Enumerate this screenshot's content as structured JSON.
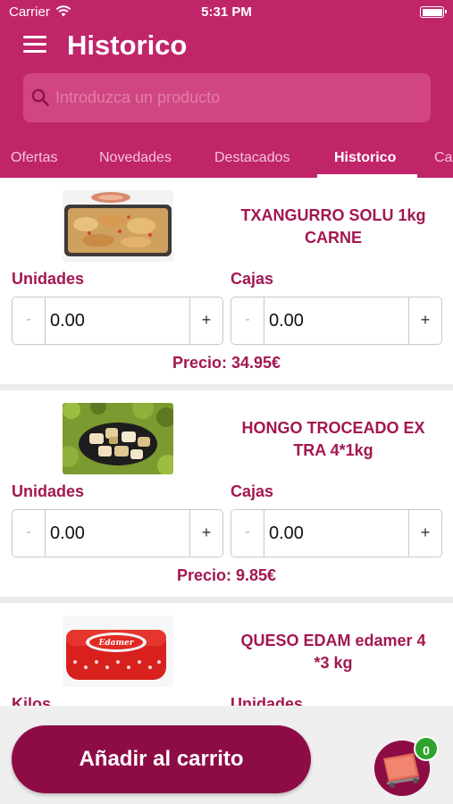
{
  "status_bar": {
    "carrier": "Carrier",
    "time": "5:31 PM"
  },
  "header": {
    "title": "Historico"
  },
  "search": {
    "placeholder": "Introduzca un producto"
  },
  "tabs": [
    {
      "label": "Ofertas",
      "active": false
    },
    {
      "label": "Novedades",
      "active": false
    },
    {
      "label": "Destacados",
      "active": false
    },
    {
      "label": "Historico",
      "active": true
    },
    {
      "label": "Ca",
      "active": false
    }
  ],
  "products": [
    {
      "name_line1": "TXANGURRO SOLU 1kg",
      "name_line2": "CARNE",
      "image_icon": "seafood-gratin-photo",
      "qty1_label": "Unidades",
      "qty1_value": "0.00",
      "qty2_label": "Cajas",
      "qty2_value": "0.00",
      "price": "Precio: 34.95€"
    },
    {
      "name_line1": "HONGO TROCEADO EX",
      "name_line2": "TRA 4*1kg",
      "image_icon": "mushroom-pieces-photo",
      "qty1_label": "Unidades",
      "qty1_value": "0.00",
      "qty2_label": "Cajas",
      "qty2_value": "0.00",
      "price": "Precio: 9.85€"
    },
    {
      "name_line1": "QUESO EDAM edamer 4",
      "name_line2": "*3 kg",
      "image_icon": "edam-cheese-photo",
      "qty1_label": "Kilos",
      "qty2_label": "Unidades"
    }
  ],
  "stepper": {
    "minus": "-",
    "plus": "+"
  },
  "footer": {
    "add_to_cart": "Añadir al carrito",
    "cart_count": "0"
  },
  "colors": {
    "primary": "#c0256a",
    "accent": "#a31751",
    "button": "#8e0c45",
    "badge": "#2ea32e"
  }
}
